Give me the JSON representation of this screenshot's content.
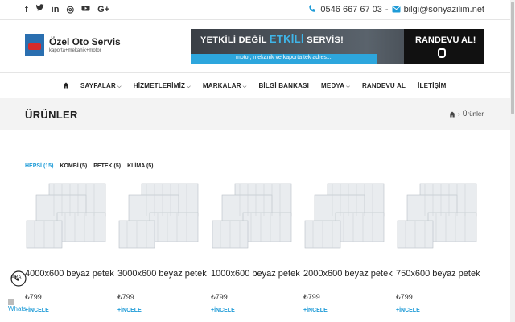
{
  "topbar": {
    "socials": [
      {
        "icon": "facebook-icon",
        "glyph": "f"
      },
      {
        "icon": "twitter-icon",
        "glyph": "🐦"
      },
      {
        "icon": "linkedin-icon",
        "glyph": "in"
      },
      {
        "icon": "instagram-icon",
        "glyph": "◎"
      },
      {
        "icon": "youtube-icon",
        "glyph": "▶"
      },
      {
        "icon": "googleplus-icon",
        "glyph": "G+"
      }
    ],
    "phone": "0546 667 67 03",
    "separator": "-",
    "email": "bilgi@sonyazilim.net"
  },
  "logo": {
    "title": "Özel Oto Servis",
    "subtitle": "kaporta+mekanik+motor"
  },
  "banner": {
    "text_pre": "YETKİLİ DEĞİL ",
    "text_highlight": "ETKİLİ",
    "text_post": " SERVİS!",
    "strip": "motor, mekanik ve kaporta tek adres...",
    "button": "RANDEVU AL!"
  },
  "nav": {
    "items": [
      {
        "label": "SAYFALAR",
        "chevron": true
      },
      {
        "label": "HİZMETLERİMİZ",
        "chevron": true
      },
      {
        "label": "MARKALAR",
        "chevron": true
      },
      {
        "label": "BİLGİ BANKASI",
        "chevron": false
      },
      {
        "label": "MEDYA",
        "chevron": true
      },
      {
        "label": "RANDEVU AL",
        "chevron": false
      },
      {
        "label": "İLETİŞİM",
        "chevron": false
      }
    ]
  },
  "page": {
    "title": "ÜRÜNLER",
    "breadcrumb_current": "Ürünler"
  },
  "filters": [
    {
      "label": "HEPSİ (15)",
      "active": true
    },
    {
      "label": "KOMBİ (5)",
      "active": false
    },
    {
      "label": "PETEK (5)",
      "active": false
    },
    {
      "label": "KLİMA (5)",
      "active": false
    }
  ],
  "products": [
    {
      "name": "4000x600 beyaz petek",
      "price": "₺799",
      "more": "+İNCELE"
    },
    {
      "name": "3000x600 beyaz petek",
      "price": "₺799",
      "more": "+İNCELE"
    },
    {
      "name": "1000x600 beyaz petek",
      "price": "₺799",
      "more": "+İNCELE"
    },
    {
      "name": "2000x600 beyaz petek",
      "price": "₺799",
      "more": "+İNCELE"
    },
    {
      "name": "750x600 beyaz petek",
      "price": "₺799",
      "more": "+İNCELE"
    }
  ],
  "widgets": {
    "call_label": "ARA",
    "whatsapp_label": "Whats"
  },
  "colors": {
    "accent": "#1e9bd7",
    "title_band": "#f3f3f3"
  }
}
